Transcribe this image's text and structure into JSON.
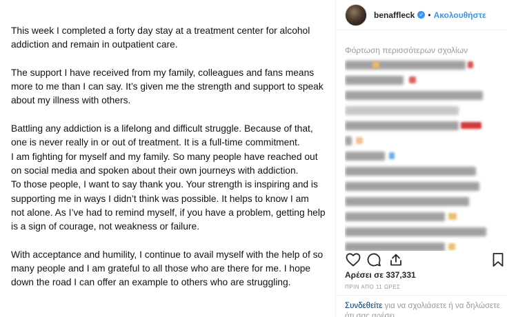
{
  "statement": {
    "paragraphs": [
      [
        "This week I completed a forty day stay at a treatment center for alcohol",
        "addiction and remain in outpatient care."
      ],
      [
        "The support I have received from my family, colleagues and fans means",
        "more to me than I can say.  It’s given me the strength and support to speak",
        "about my illness with others."
      ],
      [
        "Battling any addiction is a lifelong and difficult struggle. Because of that,",
        "one is never really in or out of treatment. It is a full-time commitment.",
        "I am fighting for myself and my family. So many people have reached out",
        "on social media and spoken about their own journeys with addiction.",
        "To those people, I want to say thank you.  Your strength is inspiring and is",
        "supporting me in ways I didn’t think was possible. It helps to know I am",
        "not alone. As I’ve had to remind myself, if you have a problem, getting help",
        "is a sign of courage, not weakness or failure."
      ],
      [
        "With acceptance and humility, I continue to avail myself with the help of so",
        "many people and I am grateful to all those who are there for me. I hope",
        "down the road I can offer an example to others who are struggling."
      ]
    ]
  },
  "header": {
    "username": "benaffleck",
    "verified_glyph": "✓",
    "separator": "•",
    "follow_label": "Ακολουθήστε"
  },
  "comments": {
    "load_more_label": "Φόρτωση περισσότερων σχολίων"
  },
  "actions": {
    "like_icon": "heart-icon",
    "comment_icon": "comment-icon",
    "share_icon": "share-icon",
    "save_icon": "bookmark-icon"
  },
  "likes_text": "Αρέσει σε 337,331",
  "time_text": "ΠΡΙΝ ΑΠΟ 11 ΩΡΕΣ",
  "login": {
    "link_text": "Συνδεθείτε",
    "rest_text": " για να σχολιάσετε ή να δηλώσετε ότι σας αρέσει."
  },
  "colors": {
    "accent": "#3897f0",
    "text": "#262626",
    "muted": "#999999"
  }
}
